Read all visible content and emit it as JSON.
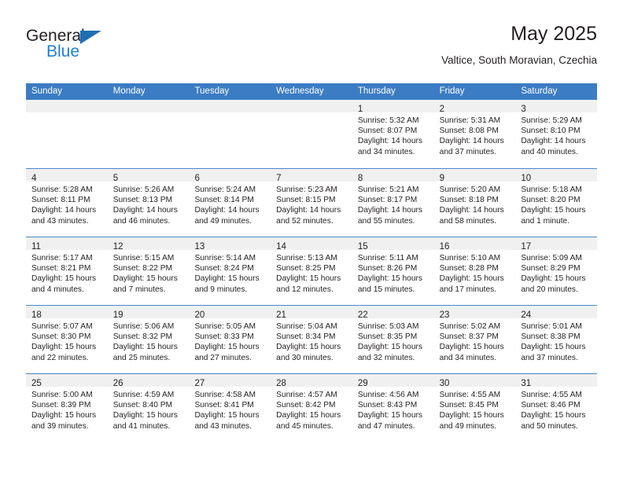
{
  "brand": {
    "name_top": "General",
    "name_bottom": "Blue",
    "triangle_color": "#1f6eb5",
    "blue_color": "#1f7fd4"
  },
  "header": {
    "title": "May 2025",
    "subtitle": "Valtice, South Moravian, Czechia"
  },
  "theme": {
    "header_bar": "#3b7cc4",
    "day_band": "#f0f0f0",
    "row_divider": "#4a86c8",
    "text": "#231f20"
  },
  "weekdays": [
    "Sunday",
    "Monday",
    "Tuesday",
    "Wednesday",
    "Thursday",
    "Friday",
    "Saturday"
  ],
  "weeks": [
    [
      {
        "day": "",
        "empty": true
      },
      {
        "day": "",
        "empty": true
      },
      {
        "day": "",
        "empty": true
      },
      {
        "day": "",
        "empty": true
      },
      {
        "day": "1",
        "sunrise": "Sunrise: 5:32 AM",
        "sunset": "Sunset: 8:07 PM",
        "daylight1": "Daylight: 14 hours",
        "daylight2": "and 34 minutes."
      },
      {
        "day": "2",
        "sunrise": "Sunrise: 5:31 AM",
        "sunset": "Sunset: 8:08 PM",
        "daylight1": "Daylight: 14 hours",
        "daylight2": "and 37 minutes."
      },
      {
        "day": "3",
        "sunrise": "Sunrise: 5:29 AM",
        "sunset": "Sunset: 8:10 PM",
        "daylight1": "Daylight: 14 hours",
        "daylight2": "and 40 minutes."
      }
    ],
    [
      {
        "day": "4",
        "sunrise": "Sunrise: 5:28 AM",
        "sunset": "Sunset: 8:11 PM",
        "daylight1": "Daylight: 14 hours",
        "daylight2": "and 43 minutes."
      },
      {
        "day": "5",
        "sunrise": "Sunrise: 5:26 AM",
        "sunset": "Sunset: 8:13 PM",
        "daylight1": "Daylight: 14 hours",
        "daylight2": "and 46 minutes."
      },
      {
        "day": "6",
        "sunrise": "Sunrise: 5:24 AM",
        "sunset": "Sunset: 8:14 PM",
        "daylight1": "Daylight: 14 hours",
        "daylight2": "and 49 minutes."
      },
      {
        "day": "7",
        "sunrise": "Sunrise: 5:23 AM",
        "sunset": "Sunset: 8:15 PM",
        "daylight1": "Daylight: 14 hours",
        "daylight2": "and 52 minutes."
      },
      {
        "day": "8",
        "sunrise": "Sunrise: 5:21 AM",
        "sunset": "Sunset: 8:17 PM",
        "daylight1": "Daylight: 14 hours",
        "daylight2": "and 55 minutes."
      },
      {
        "day": "9",
        "sunrise": "Sunrise: 5:20 AM",
        "sunset": "Sunset: 8:18 PM",
        "daylight1": "Daylight: 14 hours",
        "daylight2": "and 58 minutes."
      },
      {
        "day": "10",
        "sunrise": "Sunrise: 5:18 AM",
        "sunset": "Sunset: 8:20 PM",
        "daylight1": "Daylight: 15 hours",
        "daylight2": "and 1 minute."
      }
    ],
    [
      {
        "day": "11",
        "sunrise": "Sunrise: 5:17 AM",
        "sunset": "Sunset: 8:21 PM",
        "daylight1": "Daylight: 15 hours",
        "daylight2": "and 4 minutes."
      },
      {
        "day": "12",
        "sunrise": "Sunrise: 5:15 AM",
        "sunset": "Sunset: 8:22 PM",
        "daylight1": "Daylight: 15 hours",
        "daylight2": "and 7 minutes."
      },
      {
        "day": "13",
        "sunrise": "Sunrise: 5:14 AM",
        "sunset": "Sunset: 8:24 PM",
        "daylight1": "Daylight: 15 hours",
        "daylight2": "and 9 minutes."
      },
      {
        "day": "14",
        "sunrise": "Sunrise: 5:13 AM",
        "sunset": "Sunset: 8:25 PM",
        "daylight1": "Daylight: 15 hours",
        "daylight2": "and 12 minutes."
      },
      {
        "day": "15",
        "sunrise": "Sunrise: 5:11 AM",
        "sunset": "Sunset: 8:26 PM",
        "daylight1": "Daylight: 15 hours",
        "daylight2": "and 15 minutes."
      },
      {
        "day": "16",
        "sunrise": "Sunrise: 5:10 AM",
        "sunset": "Sunset: 8:28 PM",
        "daylight1": "Daylight: 15 hours",
        "daylight2": "and 17 minutes."
      },
      {
        "day": "17",
        "sunrise": "Sunrise: 5:09 AM",
        "sunset": "Sunset: 8:29 PM",
        "daylight1": "Daylight: 15 hours",
        "daylight2": "and 20 minutes."
      }
    ],
    [
      {
        "day": "18",
        "sunrise": "Sunrise: 5:07 AM",
        "sunset": "Sunset: 8:30 PM",
        "daylight1": "Daylight: 15 hours",
        "daylight2": "and 22 minutes."
      },
      {
        "day": "19",
        "sunrise": "Sunrise: 5:06 AM",
        "sunset": "Sunset: 8:32 PM",
        "daylight1": "Daylight: 15 hours",
        "daylight2": "and 25 minutes."
      },
      {
        "day": "20",
        "sunrise": "Sunrise: 5:05 AM",
        "sunset": "Sunset: 8:33 PM",
        "daylight1": "Daylight: 15 hours",
        "daylight2": "and 27 minutes."
      },
      {
        "day": "21",
        "sunrise": "Sunrise: 5:04 AM",
        "sunset": "Sunset: 8:34 PM",
        "daylight1": "Daylight: 15 hours",
        "daylight2": "and 30 minutes."
      },
      {
        "day": "22",
        "sunrise": "Sunrise: 5:03 AM",
        "sunset": "Sunset: 8:35 PM",
        "daylight1": "Daylight: 15 hours",
        "daylight2": "and 32 minutes."
      },
      {
        "day": "23",
        "sunrise": "Sunrise: 5:02 AM",
        "sunset": "Sunset: 8:37 PM",
        "daylight1": "Daylight: 15 hours",
        "daylight2": "and 34 minutes."
      },
      {
        "day": "24",
        "sunrise": "Sunrise: 5:01 AM",
        "sunset": "Sunset: 8:38 PM",
        "daylight1": "Daylight: 15 hours",
        "daylight2": "and 37 minutes."
      }
    ],
    [
      {
        "day": "25",
        "sunrise": "Sunrise: 5:00 AM",
        "sunset": "Sunset: 8:39 PM",
        "daylight1": "Daylight: 15 hours",
        "daylight2": "and 39 minutes."
      },
      {
        "day": "26",
        "sunrise": "Sunrise: 4:59 AM",
        "sunset": "Sunset: 8:40 PM",
        "daylight1": "Daylight: 15 hours",
        "daylight2": "and 41 minutes."
      },
      {
        "day": "27",
        "sunrise": "Sunrise: 4:58 AM",
        "sunset": "Sunset: 8:41 PM",
        "daylight1": "Daylight: 15 hours",
        "daylight2": "and 43 minutes."
      },
      {
        "day": "28",
        "sunrise": "Sunrise: 4:57 AM",
        "sunset": "Sunset: 8:42 PM",
        "daylight1": "Daylight: 15 hours",
        "daylight2": "and 45 minutes."
      },
      {
        "day": "29",
        "sunrise": "Sunrise: 4:56 AM",
        "sunset": "Sunset: 8:43 PM",
        "daylight1": "Daylight: 15 hours",
        "daylight2": "and 47 minutes."
      },
      {
        "day": "30",
        "sunrise": "Sunrise: 4:55 AM",
        "sunset": "Sunset: 8:45 PM",
        "daylight1": "Daylight: 15 hours",
        "daylight2": "and 49 minutes."
      },
      {
        "day": "31",
        "sunrise": "Sunrise: 4:55 AM",
        "sunset": "Sunset: 8:46 PM",
        "daylight1": "Daylight: 15 hours",
        "daylight2": "and 50 minutes."
      }
    ]
  ]
}
